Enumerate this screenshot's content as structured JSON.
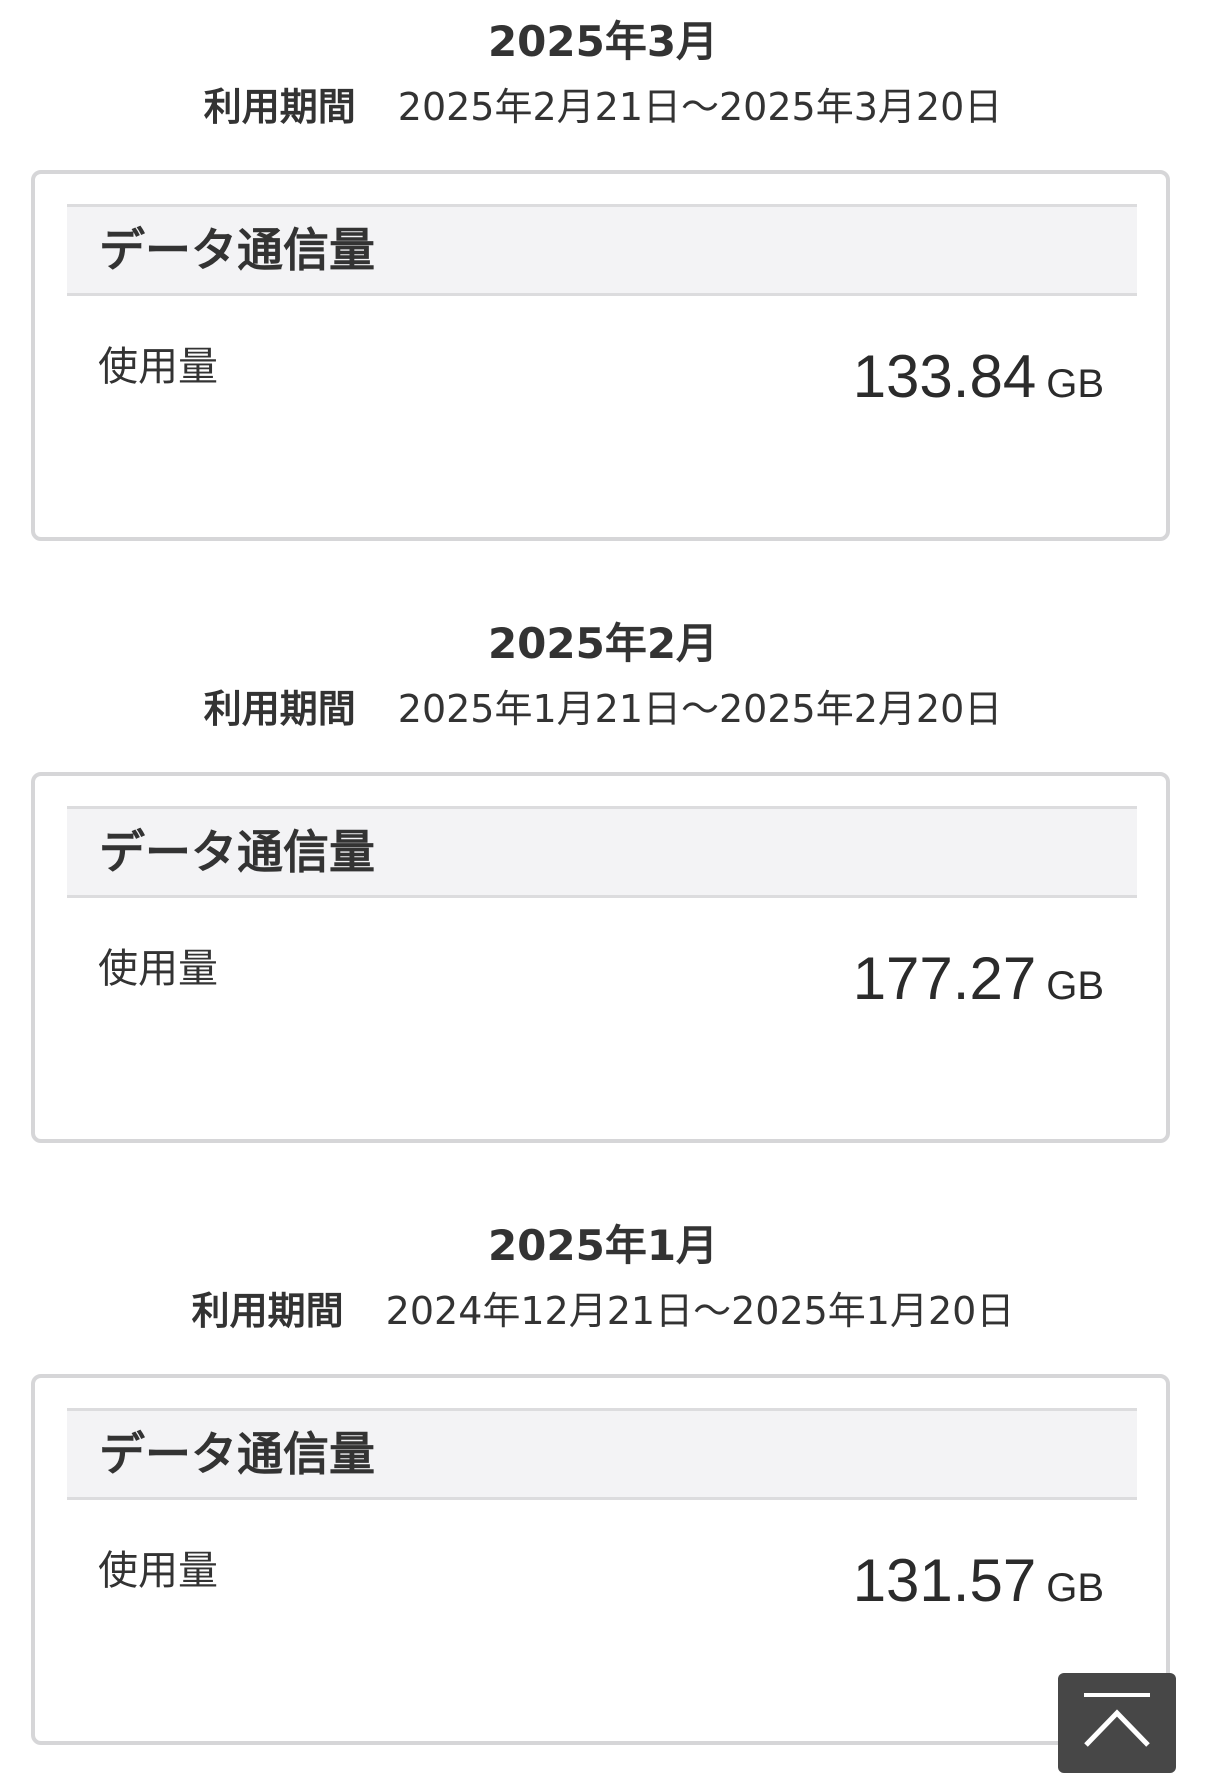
{
  "months": [
    {
      "title": "2025年3月",
      "period_label": "利用期間",
      "period_value": "2025年2月21日〜2025年3月20日",
      "card_title": "データ通信量",
      "usage_label": "使用量",
      "usage_value": "133.84",
      "usage_unit": "GB"
    },
    {
      "title": "2025年2月",
      "period_label": "利用期間",
      "period_value": "2025年1月21日〜2025年2月20日",
      "card_title": "データ通信量",
      "usage_label": "使用量",
      "usage_value": "177.27",
      "usage_unit": "GB"
    },
    {
      "title": "2025年1月",
      "period_label": "利用期間",
      "period_value": "2024年12月21日〜2025年1月20日",
      "card_title": "データ通信量",
      "usage_label": "使用量",
      "usage_value": "131.57",
      "usage_unit": "GB"
    }
  ],
  "scroll_top_button": {
    "icon": "chevron-up-icon"
  },
  "colors": {
    "text": "#333333",
    "card_border": "#d6d6d8",
    "header_bg": "#f3f3f5",
    "scroll_button_bg": "#474747"
  }
}
